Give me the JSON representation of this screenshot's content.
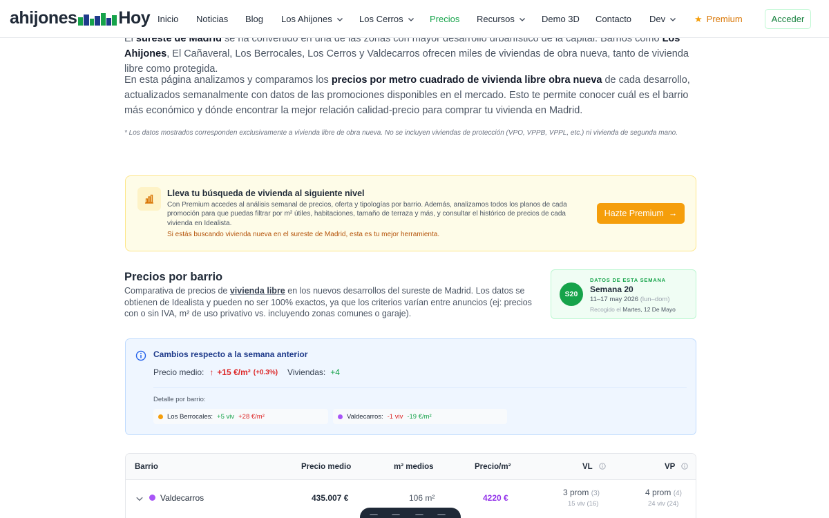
{
  "nav": {
    "logo_part1": "ahijones",
    "logo_part2": "Hoy",
    "items": [
      {
        "label": "Inicio"
      },
      {
        "label": "Noticias"
      },
      {
        "label": "Blog"
      },
      {
        "label": "Los Ahijones"
      },
      {
        "label": "Los Cerros"
      },
      {
        "label": "Precios"
      },
      {
        "label": "Recursos"
      },
      {
        "label": "Demo 3D"
      },
      {
        "label": "Contacto"
      },
      {
        "label": "Dev"
      }
    ],
    "premium_label": "Premium",
    "login_label": "Acceder",
    "colors": {
      "accent": "#16a34a",
      "premium": "#d97706"
    }
  },
  "intro": {
    "p1": {
      "a": "El ",
      "b1": "sureste de Madrid",
      "c": " se ha convertido en una de las zonas con mayor desarrollo urbanístico de la capital. Barrios como ",
      "b2": "Los Ahijones",
      "d": ", El Cañaveral, Los Berrocales, Los Cerros y Valdecarros ofrecen miles de viviendas de obra nueva, tanto de vivienda libre como protegida."
    },
    "p2": {
      "a": "En esta página analizamos y comparamos los ",
      "b": "precios por metro cuadrado de vivienda libre obra nueva",
      "c": " de cada desarrollo, actualizados semanalmente con datos de las promociones disponibles en el mercado. Esto te permite conocer cuál es el barrio más económico y dónde encontrar la mejor relación calidad-precio para comprar tu vivienda en Madrid."
    },
    "note": "* Los datos mostrados corresponden exclusivamente a vivienda libre de obra nueva. No se incluyen viviendas de protección (VPO, VPPB, VPPL, etc.) ni vivienda de segunda mano."
  },
  "promo": {
    "icon": "chart-icon",
    "title": "Lleva tu búsqueda de vivienda al siguiente nivel",
    "desc": "Con Premium accedes al análisis semanal de precios, oferta y tipologías por barrio. Además, analizamos todos los planos de cada promoción para que puedas filtrar por m² útiles, habitaciones, tamaño de terraza y más, y consultar el histórico de precios de cada vivienda en Idealista.",
    "cta_text": "Si estás buscando vivienda nueva en el sureste de Madrid, esta es tu mejor herramienta.",
    "button": "Hazte Premium"
  },
  "section": {
    "title": "Precios por barrio",
    "desc_a": "Comparativa de precios de ",
    "desc_link": "vivienda libre",
    "desc_b": " en los nuevos desarrollos del sureste de Madrid. Los datos se obtienen de Idealista y pueden no ser 100% exactos, ya que los criterios varían entre anuncios (ej: precios con o sin IVA, m² de uso privativo vs. incluyendo zonas comunes o garaje)."
  },
  "week": {
    "badge": "S20",
    "kicker": "DATOS DE ESTA SEMANA",
    "title": "Semana 20",
    "range": "11–17 may 2026",
    "range_days": "(lun–dom)",
    "collected_label": "Recogido el",
    "collected_date": "Martes, 12 De Mayo"
  },
  "changes": {
    "title": "Cambios respecto a la semana anterior",
    "price_label": "Precio medio:",
    "price_delta": "+15 €/m²",
    "price_pct": "(+0.3%)",
    "viv_label": "Viviendas:",
    "viv_delta": "+4",
    "detail_label": "Detalle por barrio:",
    "chips": [
      {
        "barrio": "Los Berrocales:",
        "viv": "+5 viv",
        "price": "+28 €/m²",
        "dot": "#f59e0b"
      },
      {
        "barrio": "Valdecarros:",
        "viv": "-1 viv",
        "price": "-19 €/m²",
        "dot": "#a855f7"
      }
    ]
  },
  "table": {
    "headers": {
      "barrio": "Barrio",
      "precio": "Precio medio",
      "m2": "m² medios",
      "precio_m2": "Precio/m²",
      "vl": "VL",
      "vp": "VP"
    },
    "rows": [
      {
        "barrio": "Valdecarros",
        "dot": "#a855f7",
        "precio": "435.007 €",
        "m2": "106 m²",
        "precio_m2": "4220 €",
        "vl_prom": "3 prom",
        "vl_prom_prev": "(3)",
        "vl_viv": "15 viv",
        "vl_viv_prev": "(16)",
        "vp_prom": "4 prom",
        "vp_prom_prev": "(4)",
        "vp_viv": "24 viv",
        "vp_viv_prev": "(24)"
      }
    ]
  }
}
